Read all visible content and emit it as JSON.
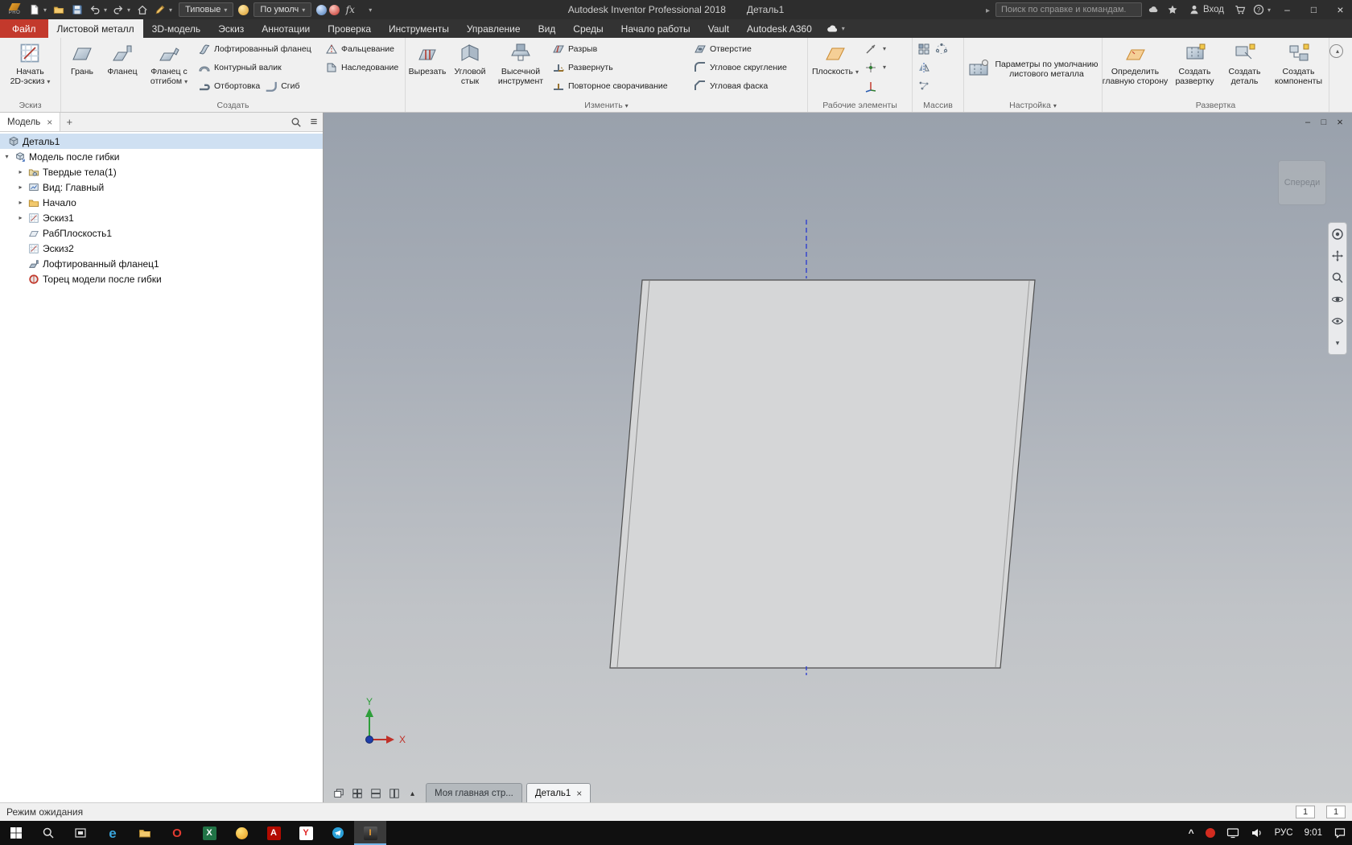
{
  "titlebar": {
    "logo": "PRO",
    "preset_dropdown": "Типовые",
    "material_dropdown": "По умолч",
    "app_title": "Autodesk Inventor Professional 2018",
    "doc_title": "Деталь1",
    "search_placeholder": "Поиск по справке и командам.",
    "signin_label": "Вход"
  },
  "tab_bar": {
    "file_tab": "Файл",
    "tabs": [
      "Листовой металл",
      "3D-модель",
      "Эскиз",
      "Аннотации",
      "Проверка",
      "Инструменты",
      "Управление",
      "Вид",
      "Среды",
      "Начало работы",
      "Vault",
      "Autodesk A360"
    ]
  },
  "ribbon": {
    "sketch": {
      "label": "Эскиз",
      "start1": "Начать",
      "start2": "2D-эскиз"
    },
    "create": {
      "label": "Создать",
      "face": "Грань",
      "flange": "Фланец",
      "flange2_1": "Фланец с",
      "flange2_2": "отгибом",
      "lofted": "Лофтированный фланец",
      "contour": "Контурный валик",
      "hem": "Отбортовка",
      "bend": "Сгиб",
      "fold": "Фальцевание",
      "derive": "Наследование"
    },
    "modify": {
      "label": "Изменить",
      "cut": "Вырезать",
      "seam1": "Угловой",
      "seam2": "стык",
      "punch1": "Высечной",
      "punch2": "инструмент",
      "rip": "Разрыв",
      "unfold": "Развернуть",
      "refold": "Повторное сворачивание",
      "hole": "Отверстие",
      "round": "Угловое скругление",
      "chamfer": "Угловая фаска"
    },
    "work": {
      "label": "Рабочие элементы",
      "plane": "Плоскость"
    },
    "pattern": {
      "label": "Массив"
    },
    "setup": {
      "label": "Настройка",
      "defaults1": "Параметры по умолчанию",
      "defaults2": "листового металла"
    },
    "flat": {
      "label": "Развертка",
      "define1": "Определить",
      "define2": "главную сторону",
      "flat1": "Создать",
      "flat2": "развертку",
      "part1": "Создать",
      "part2": "деталь",
      "comp1": "Создать",
      "comp2": "компоненты"
    }
  },
  "browser": {
    "tab_label": "Модель",
    "tree": [
      {
        "label": "Деталь1"
      },
      {
        "label": "Модель после гибки"
      },
      {
        "label": "Твердые тела(1)"
      },
      {
        "label": "Вид: Главный"
      },
      {
        "label": "Начало"
      },
      {
        "label": "Эскиз1"
      },
      {
        "label": "РабПлоскость1"
      },
      {
        "label": "Эскиз2"
      },
      {
        "label": "Лофтированный фланец1"
      },
      {
        "label": "Торец модели после гибки"
      }
    ]
  },
  "viewport": {
    "viewcube": "Спереди",
    "axis_x": "X",
    "axis_y": "Y"
  },
  "doc_bar": {
    "home_tab": "Моя главная стр...",
    "part_tab": "Деталь1"
  },
  "statusbar": {
    "message": "Режим ожидания",
    "counter1": "1",
    "counter2": "1"
  },
  "taskbar": {
    "lang": "РУС",
    "time": "9:01",
    "app_glyphs": {
      "edge": "e",
      "opera": "O",
      "excel": "X",
      "acrobat": "A",
      "yandex": "Y",
      "inventor": "I"
    }
  },
  "colors": {
    "file_tab_red": "#c3392c",
    "titlebar": "#2d2d2d",
    "ribbon_bg": "#f0f0f0",
    "selection": "#cfe0f2",
    "viewport_top": "#99a1ac",
    "viewport_bottom": "#c9cbcd",
    "taskbar": "#101010"
  }
}
